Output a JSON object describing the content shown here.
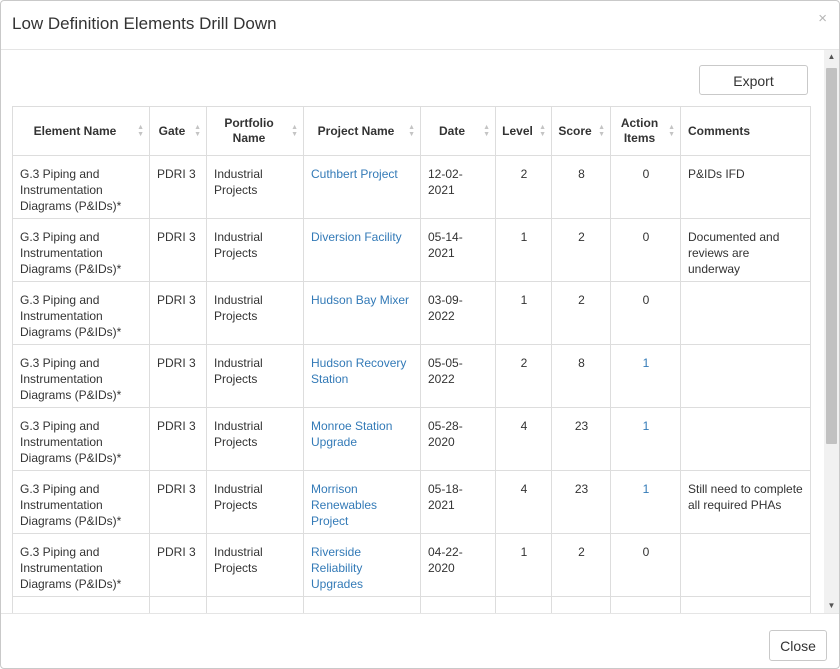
{
  "modal": {
    "title": "Low Definition Elements Drill Down",
    "close_icon": "×",
    "export_label": "Export",
    "close_label": "Close"
  },
  "table": {
    "columns": [
      "Element Name",
      "Gate",
      "Portfolio Name",
      "Project Name",
      "Date",
      "Level",
      "Score",
      "Action Items",
      "Comments"
    ],
    "rows": [
      {
        "element": "G.3 Piping and Instrumentation Diagrams (P&IDs)*",
        "gate": "PDRI 3",
        "portfolio": "Industrial Projects",
        "project": "Cuthbert Project",
        "date": "12-02-2021",
        "level": "2",
        "score": "8",
        "action_items": "0",
        "comments": "P&IDs IFD"
      },
      {
        "element": "G.3 Piping and Instrumentation Diagrams (P&IDs)*",
        "gate": "PDRI 3",
        "portfolio": "Industrial Projects",
        "project": "Diversion Facility",
        "date": "05-14-2021",
        "level": "1",
        "score": "2",
        "action_items": "0",
        "comments": "Documented and reviews are underway"
      },
      {
        "element": "G.3 Piping and Instrumentation Diagrams (P&IDs)*",
        "gate": "PDRI 3",
        "portfolio": "Industrial Projects",
        "project": "Hudson Bay Mixer",
        "date": "03-09-2022",
        "level": "1",
        "score": "2",
        "action_items": "0",
        "comments": ""
      },
      {
        "element": "G.3 Piping and Instrumentation Diagrams (P&IDs)*",
        "gate": "PDRI 3",
        "portfolio": "Industrial Projects",
        "project": "Hudson Recovery Station",
        "date": "05-05-2022",
        "level": "2",
        "score": "8",
        "action_items": "1",
        "comments": ""
      },
      {
        "element": "G.3 Piping and Instrumentation Diagrams (P&IDs)*",
        "gate": "PDRI 3",
        "portfolio": "Industrial Projects",
        "project": "Monroe Station Upgrade",
        "date": "05-28-2020",
        "level": "4",
        "score": "23",
        "action_items": "1",
        "comments": ""
      },
      {
        "element": "G.3 Piping and Instrumentation Diagrams (P&IDs)*",
        "gate": "PDRI 3",
        "portfolio": "Industrial Projects",
        "project": "Morrison Renewables Project",
        "date": "05-18-2021",
        "level": "4",
        "score": "23",
        "action_items": "1",
        "comments": "Still need to complete all required PHAs"
      },
      {
        "element": "G.3 Piping and Instrumentation Diagrams (P&IDs)*",
        "gate": "PDRI 3",
        "portfolio": "Industrial Projects",
        "project": "Riverside Reliability Upgrades",
        "date": "04-22-2020",
        "level": "1",
        "score": "2",
        "action_items": "0",
        "comments": ""
      },
      {
        "element": "",
        "gate": "",
        "portfolio": "",
        "project": "",
        "date": "",
        "level": "",
        "score": "",
        "action_items": "",
        "comments": ""
      }
    ]
  },
  "colors": {
    "link": "#337ab7",
    "border": "#dddddd",
    "text": "#333333"
  }
}
